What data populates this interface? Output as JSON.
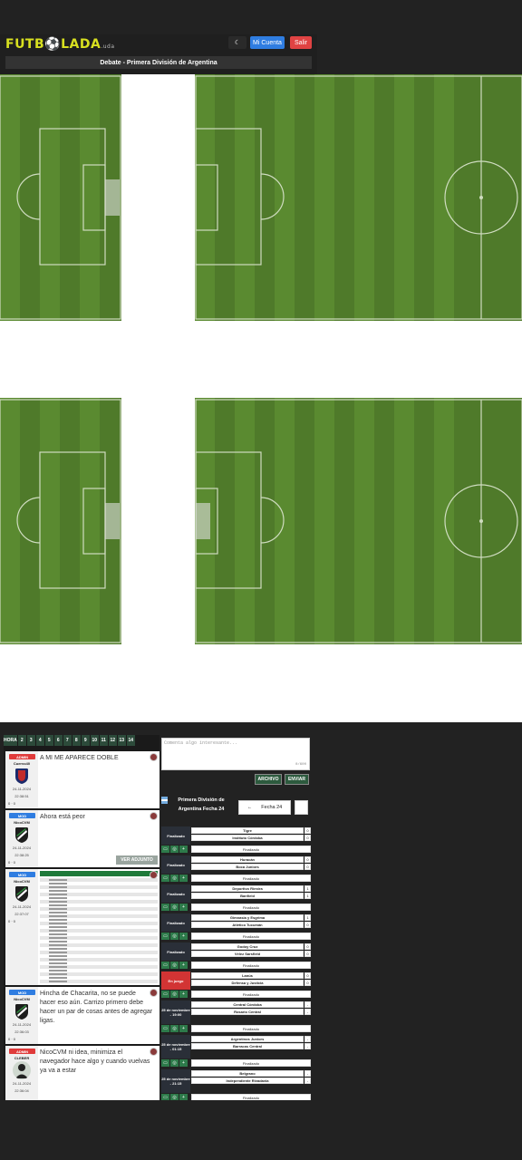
{
  "header": {
    "logo_main": "FUTB",
    "logo_ball": "⚽",
    "logo_tail": "LADA",
    "logo_suffix": ".uda",
    "moon_icon": "☾",
    "my_account": "Mi Cuenta",
    "logout": "Salir",
    "debate_title": "Debate - Primera División de Argentina"
  },
  "colors": {
    "accent_green": "#2d5a3e",
    "grass_dark": "#4f7a2a",
    "grass_light": "#5e8c32",
    "admin": "#e03b3b",
    "mod": "#2f7de1"
  },
  "pagination": [
    "HORA",
    "2",
    "3",
    "4",
    "5",
    "6",
    "7",
    "8",
    "9",
    "10",
    "11",
    "12",
    "13",
    "14"
  ],
  "posts": [
    {
      "role": "ADMIN",
      "user": "Cuervo40",
      "date": "24-11-2024",
      "time": "22:38:51",
      "votes": "0 · 0",
      "text": "A MI ME APARECE DOBLE",
      "attach": ""
    },
    {
      "role": "MOD",
      "user": "NicoCVM",
      "date": "24-11-2024",
      "time": "22:38:25",
      "votes": "0 · 0",
      "text": "Ahora está peor",
      "attach": "VER ADJUNTO"
    },
    {
      "role": "MOD",
      "user": "NicoCVM",
      "date": "24-11-2024",
      "time": "22:37:07",
      "votes": "0 · 0",
      "text": "",
      "attach": ""
    },
    {
      "role": "MOD",
      "user": "NicoCVM",
      "date": "24-11-2024",
      "time": "22:36:03",
      "votes": "0 · 0",
      "text": "Hincha de Chacarita, no se puede hacer eso aún. Carrizo primero debe hacer un par de cosas antes de agregar ligas.",
      "attach": ""
    },
    {
      "role": "ADMIN",
      "user": "CLEBER",
      "date": "24-11-2024",
      "time": "22:36:04",
      "votes": "",
      "text": "NicoCVM ni idea, minimiza el navegador hace algo y cuando vuelvas ya va a estar",
      "attach": ""
    }
  ],
  "comment_box": {
    "placeholder": "Comenta algo interesante...",
    "count": "0/600",
    "archive": "ARCHIVO",
    "send": "ENVIAR"
  },
  "league": {
    "title": "Primera División de Argentina Fecha 24",
    "fecha": "Fecha 24",
    "arrow_icon": "←"
  },
  "matches": [
    {
      "status": "Finalizado",
      "home": "Tigre",
      "away": "Instituto Córdoba",
      "hs": "0",
      "as": "0",
      "final": "Finalizado"
    },
    {
      "status": "Finalizado",
      "home": "Huracán",
      "away": "Boca Juniors",
      "hs": "0",
      "as": "0",
      "final": "Finalizado"
    },
    {
      "status": "Finalizado",
      "home": "Deportivo Riestra",
      "away": "Banfield",
      "hs": "1",
      "as": "1",
      "final": "Finalizado"
    },
    {
      "status": "Finalizado",
      "home": "Gimnasia y Esgrima",
      "away": "Atlético Tucumán",
      "hs": "1",
      "as": "0",
      "final": "Finalizado"
    },
    {
      "status": "Finalizado",
      "home": "Godoy Cruz",
      "away": "Vélez Sarsfield",
      "hs": "0",
      "as": "0",
      "final": "Finalizado"
    },
    {
      "status": "En juego",
      "home": "Lanús",
      "away": "Defensa y Justicia",
      "hs": "0",
      "as": "0",
      "final": "Finalizado"
    },
    {
      "status": "25 de noviembre - 19:00",
      "home": "Central Córdoba",
      "away": "Rosario Central",
      "hs": "-",
      "as": "-",
      "final": "Finalizado"
    },
    {
      "status": "25 de noviembre - 01:15",
      "home": "Argentinos Juniors",
      "away": "Barracas Central",
      "hs": "-",
      "as": "-",
      "final": "Finalizado"
    },
    {
      "status": "25 de noviembre - 21:15",
      "home": "Belgrano",
      "away": "Independiente Rivadavia",
      "hs": "-",
      "as": "-",
      "final": "Finalizado"
    }
  ]
}
